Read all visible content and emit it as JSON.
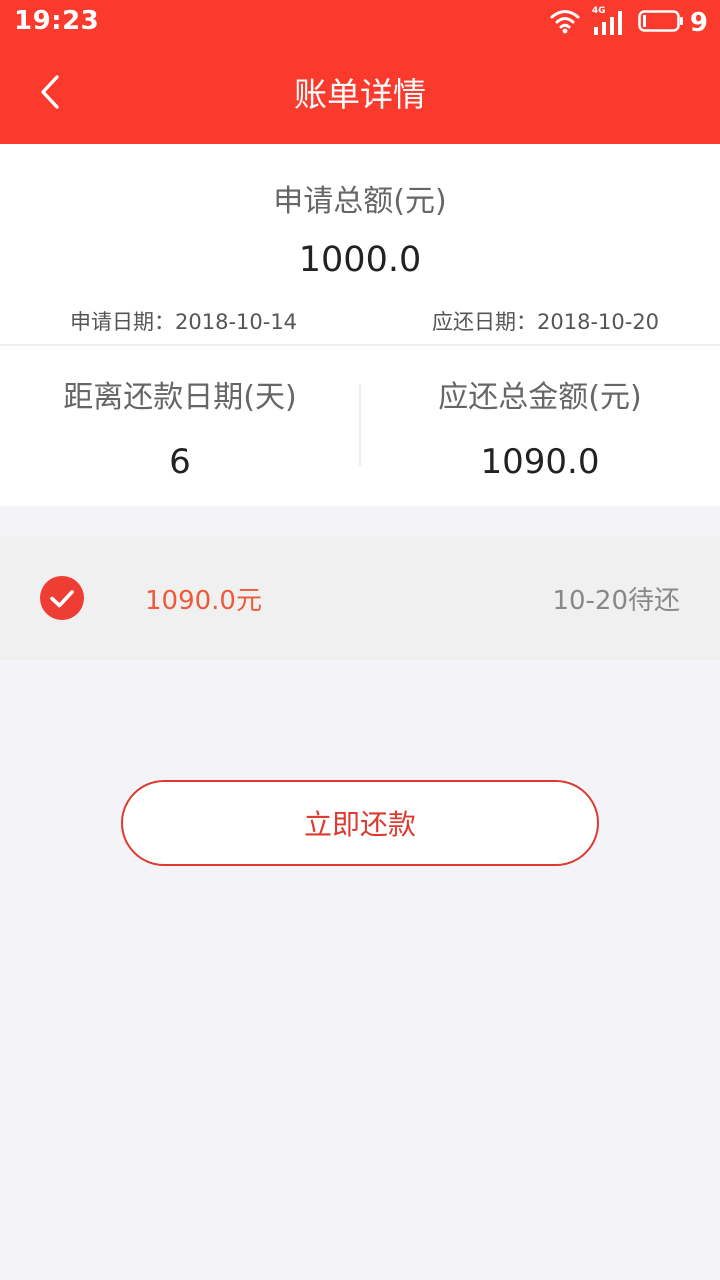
{
  "status_bar": {
    "time": "19:23",
    "network": "4G",
    "battery": "9",
    "icons": [
      "wifi-icon",
      "cellular-signal-icon",
      "battery-icon"
    ]
  },
  "nav": {
    "back_icon": "chevron-left-icon",
    "title": "账单详情"
  },
  "summary": {
    "apply_label": "申请总额(元)",
    "apply_amount": "1000.0",
    "apply_date": "申请日期：2018-10-14",
    "due_date": "应还日期：2018-10-20",
    "days_label": "距离还款日期(天)",
    "days_value": "6",
    "total_label": "应还总金额(元)",
    "total_value": "1090.0"
  },
  "bill": {
    "check_icon": "check-circle-icon",
    "amount": "1090.0元",
    "status": "10-20待还"
  },
  "actions": {
    "repay_label": "立即还款"
  },
  "colors": {
    "brand": "#fb3a2e",
    "accent_text": "#ee5a3a",
    "button_border": "#de3a30",
    "page_bg": "#f4f4f8"
  }
}
